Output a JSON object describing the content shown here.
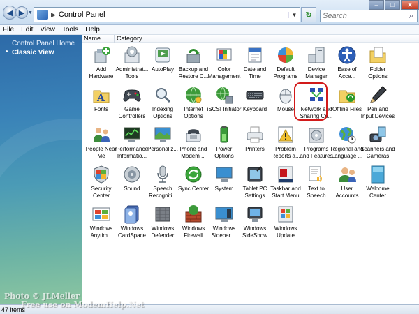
{
  "window": {
    "address_path": "Control Panel",
    "search_placeholder": "Search"
  },
  "menu": [
    "File",
    "Edit",
    "View",
    "Tools",
    "Help"
  ],
  "sidebar": {
    "items": [
      {
        "label": "Control Panel Home"
      },
      {
        "label": "Classic View"
      }
    ]
  },
  "columns": {
    "name": "Name",
    "category": "Category"
  },
  "items": [
    {
      "label": "Add\nHardware",
      "icon": "add-hardware-icon"
    },
    {
      "label": "Administrat...\nTools",
      "icon": "administrative-tools-icon"
    },
    {
      "label": "AutoPlay",
      "icon": "autoplay-icon"
    },
    {
      "label": "Backup and\nRestore C...",
      "icon": "backup-restore-icon"
    },
    {
      "label": "Color\nManagement",
      "icon": "color-management-icon"
    },
    {
      "label": "Date and\nTime",
      "icon": "date-time-icon"
    },
    {
      "label": "Default\nPrograms",
      "icon": "default-programs-icon"
    },
    {
      "label": "Device\nManager",
      "icon": "device-manager-icon"
    },
    {
      "label": "Ease of\nAcce...",
      "icon": "ease-of-access-icon"
    },
    {
      "label": "Folder\nOptions",
      "icon": "folder-options-icon"
    },
    {
      "label": "Fonts",
      "icon": "fonts-icon"
    },
    {
      "label": "Game\nControllers",
      "icon": "game-controllers-icon"
    },
    {
      "label": "Indexing\nOptions",
      "icon": "indexing-options-icon"
    },
    {
      "label": "Internet\nOptions",
      "icon": "internet-options-icon"
    },
    {
      "label": "iSCSI Initiator",
      "icon": "iscsi-initiator-icon"
    },
    {
      "label": "Keyboard",
      "icon": "keyboard-icon"
    },
    {
      "label": "Mouse",
      "icon": "mouse-icon"
    },
    {
      "label": "Network and\nSharing Ce...",
      "icon": "network-sharing-icon"
    },
    {
      "label": "Offline Files",
      "icon": "offline-files-icon"
    },
    {
      "label": "Pen and\nInput Devices",
      "icon": "pen-input-icon"
    },
    {
      "label": "People Near\nMe",
      "icon": "people-near-me-icon"
    },
    {
      "label": "Performance\nInformatio...",
      "icon": "performance-icon"
    },
    {
      "label": "Personaliz...",
      "icon": "personalization-icon"
    },
    {
      "label": "Phone and\nModem ...",
      "icon": "phone-modem-icon"
    },
    {
      "label": "Power\nOptions",
      "icon": "power-options-icon"
    },
    {
      "label": "Printers",
      "icon": "printers-icon"
    },
    {
      "label": "Problem\nReports a...",
      "icon": "problem-reports-icon"
    },
    {
      "label": "Programs\nand Features",
      "icon": "programs-features-icon"
    },
    {
      "label": "Regional and\nLanguage ...",
      "icon": "regional-language-icon"
    },
    {
      "label": "Scanners and\nCameras",
      "icon": "scanners-cameras-icon"
    },
    {
      "label": "Security\nCenter",
      "icon": "security-center-icon"
    },
    {
      "label": "Sound",
      "icon": "sound-icon"
    },
    {
      "label": "Speech\nRecogniti...",
      "icon": "speech-recognition-icon"
    },
    {
      "label": "Sync Center",
      "icon": "sync-center-icon"
    },
    {
      "label": "System",
      "icon": "system-icon"
    },
    {
      "label": "Tablet PC\nSettings",
      "icon": "tablet-pc-icon"
    },
    {
      "label": "Taskbar and\nStart Menu",
      "icon": "taskbar-icon"
    },
    {
      "label": "Text to\nSpeech",
      "icon": "text-to-speech-icon"
    },
    {
      "label": "User\nAccounts",
      "icon": "user-accounts-icon"
    },
    {
      "label": "Welcome\nCenter",
      "icon": "welcome-center-icon"
    },
    {
      "label": "Windows\nAnytim...",
      "icon": "windows-anytime-icon"
    },
    {
      "label": "Windows\nCardSpace",
      "icon": "cardspace-icon"
    },
    {
      "label": "Windows\nDefender",
      "icon": "defender-icon"
    },
    {
      "label": "Windows\nFirewall",
      "icon": "firewall-icon"
    },
    {
      "label": "Windows\nSidebar ...",
      "icon": "sidebar-icon"
    },
    {
      "label": "Windows\nSideShow",
      "icon": "sideshow-icon"
    },
    {
      "label": "Windows\nUpdate",
      "icon": "windows-update-icon"
    }
  ],
  "status": "47 items",
  "watermark": {
    "line1": "Photo © JLMeller",
    "line2": "Free use on ModemHelp.Net"
  }
}
